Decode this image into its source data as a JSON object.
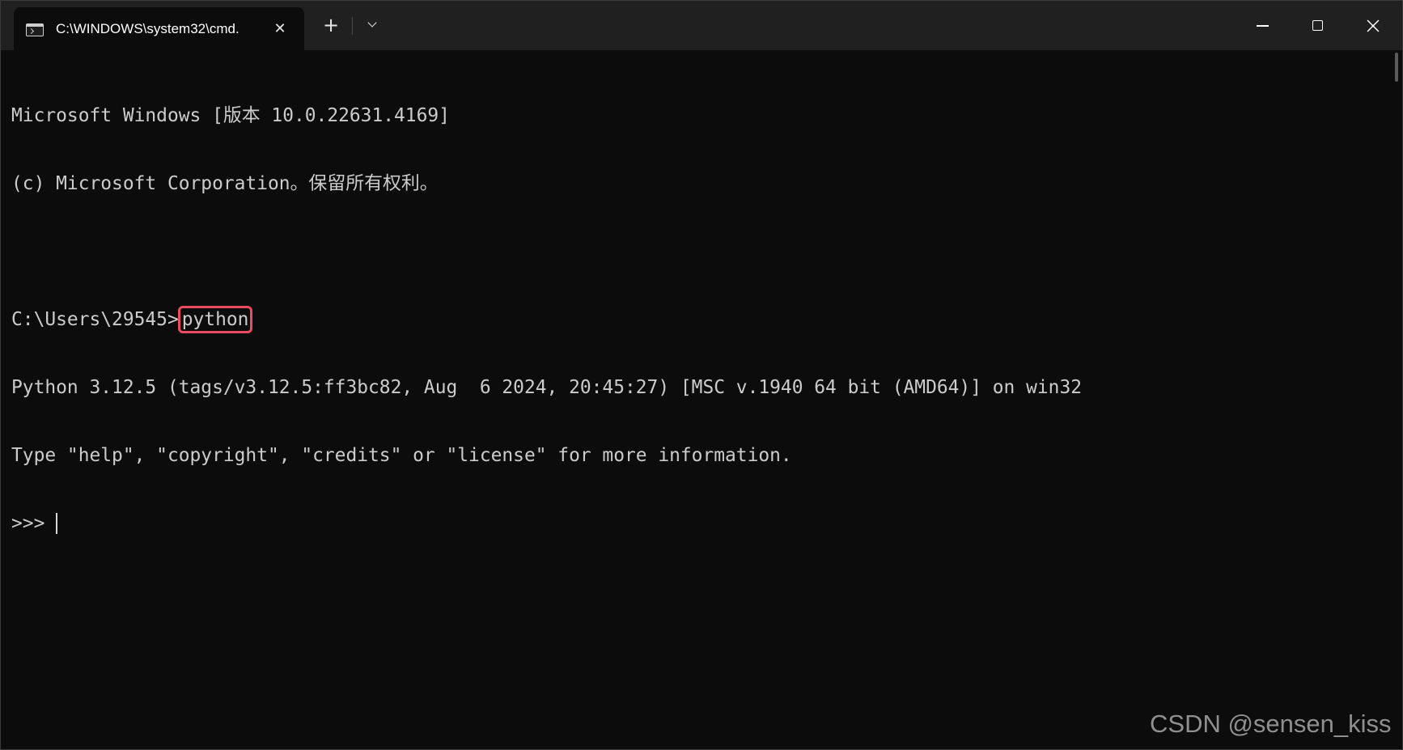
{
  "window": {
    "tab_title": "C:\\WINDOWS\\system32\\cmd.",
    "tab_icon": "cmd-terminal-icon",
    "new_tab_symbol": "+",
    "close_tab_symbol": "✕"
  },
  "terminal": {
    "lines": [
      "Microsoft Windows [版本 10.0.22631.4169]",
      "(c) Microsoft Corporation。保留所有权利。",
      "",
      "",
      "Python 3.12.5 (tags/v3.12.5:ff3bc82, Aug  6 2024, 20:45:27) [MSC v.1940 64 bit (AMD64)] on win32",
      "Type \"help\", \"copyright\", \"credits\" or \"license\" for more information."
    ],
    "prompt": "C:\\Users\\29545>",
    "command": "python",
    "repl_prompt": ">>> "
  },
  "colors": {
    "background": "#0c0c0c",
    "titlebar": "#202020",
    "text": "#cccccc",
    "highlight": "#ea4b5f"
  },
  "watermark": "CSDN @sensen_kiss"
}
